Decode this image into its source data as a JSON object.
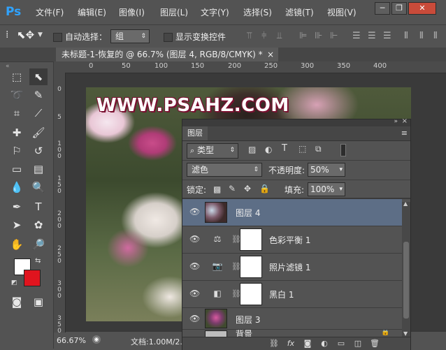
{
  "app": {
    "logo": "Ps"
  },
  "menu": [
    "文件(F)",
    "编辑(E)",
    "图像(I)",
    "图层(L)",
    "文字(Y)",
    "选择(S)",
    "滤镜(T)",
    "视图(V)"
  ],
  "window_controls": {
    "minimize": "─",
    "restore": "❐",
    "close": "✕"
  },
  "options_bar": {
    "auto_select_label": "自动选择：",
    "auto_select_target": "组",
    "show_transform_label": "显示变换控件"
  },
  "document_tab": {
    "title": "未标题-1-恢复的 @ 66.7% (图层 4, RGB/8/CMYK) *",
    "close": "×"
  },
  "ruler": {
    "horizontal": [
      "0",
      "50",
      "100",
      "150",
      "200",
      "250",
      "300",
      "350",
      "400"
    ],
    "vertical": [
      "0",
      "5",
      "1 0 0",
      "1 5 0",
      "2 0 0",
      "2 5 0",
      "3 0 0",
      "3 5 0"
    ]
  },
  "canvas": {
    "watermark": "WWW.PSAHZ.COM"
  },
  "status": {
    "zoom": "66.67%",
    "doc": "文档:1.00M/2."
  },
  "colors": {
    "foreground": "#ffffff",
    "background": "#e0141e",
    "selection": "#5d6e86",
    "ps_blue": "#2fa3ff"
  },
  "layers_panel": {
    "tab": "图层",
    "filter_type": "类型",
    "blend_mode": "滤色",
    "opacity_label": "不透明度:",
    "opacity_value": "50%",
    "lock_label": "锁定:",
    "fill_label": "填充:",
    "fill_value": "100%",
    "layers": [
      {
        "name": "图层 4",
        "kind": "image",
        "selected": true
      },
      {
        "name": "色彩平衡 1",
        "kind": "adjustment",
        "icon": "balance-icon"
      },
      {
        "name": "照片滤镜 1",
        "kind": "adjustment",
        "icon": "camera-icon"
      },
      {
        "name": "黑白 1",
        "kind": "adjustment",
        "icon": "black-white-icon"
      },
      {
        "name": "图层 3",
        "kind": "image"
      },
      {
        "name": "背景",
        "kind": "background"
      }
    ],
    "footer_fx": "fx"
  }
}
